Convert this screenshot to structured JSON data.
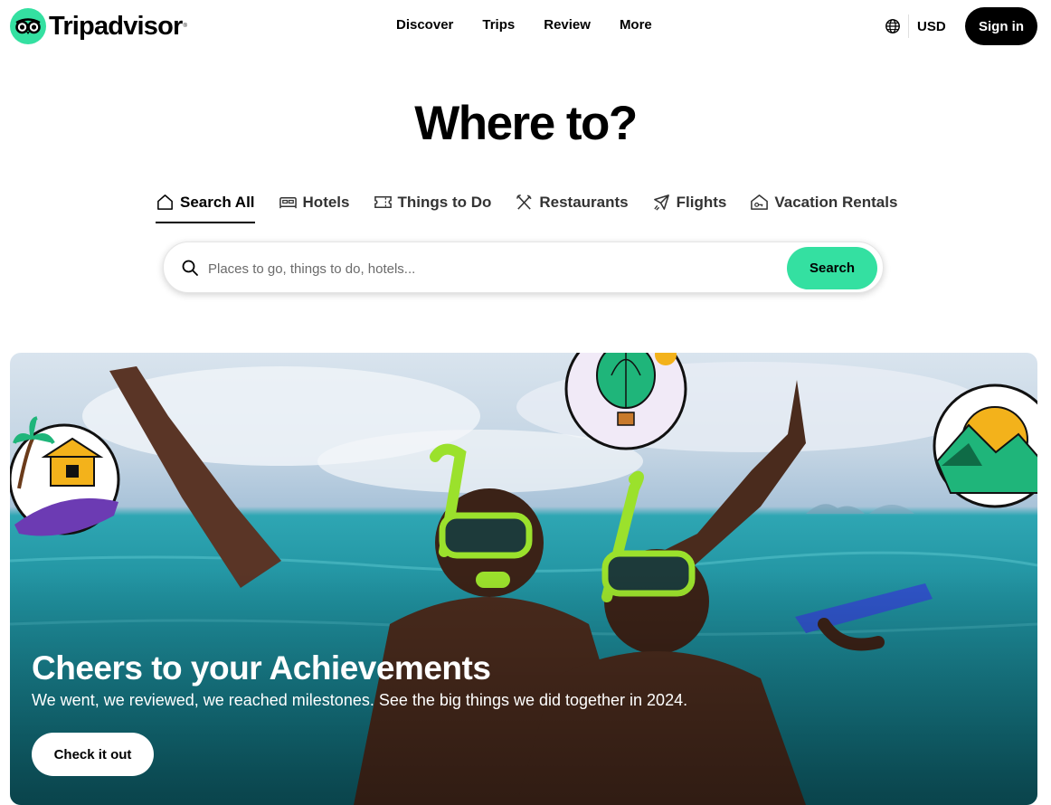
{
  "header": {
    "logo_text": "Tripadvisor",
    "logo_tm": "®",
    "nav": [
      "Discover",
      "Trips",
      "Review",
      "More"
    ],
    "currency": "USD",
    "signin_label": "Sign in"
  },
  "hero": {
    "title": "Where to?"
  },
  "tabs": [
    {
      "label": "Search All",
      "icon": "home-icon",
      "active": true
    },
    {
      "label": "Hotels",
      "icon": "bed-icon",
      "active": false
    },
    {
      "label": "Things to Do",
      "icon": "ticket-icon",
      "active": false
    },
    {
      "label": "Restaurants",
      "icon": "fork-knife-icon",
      "active": false
    },
    {
      "label": "Flights",
      "icon": "plane-icon",
      "active": false
    },
    {
      "label": "Vacation Rentals",
      "icon": "house-key-icon",
      "active": false
    }
  ],
  "search": {
    "placeholder": "Places to go, things to do, hotels...",
    "value": "",
    "button_label": "Search"
  },
  "banner": {
    "title": "Cheers to your Achievements",
    "subtitle": "We went, we reviewed, we reached milestones. See the big things we did together in 2024.",
    "cta_label": "Check it out"
  },
  "colors": {
    "brand_green": "#34e0a1",
    "black": "#000000",
    "white": "#ffffff"
  }
}
